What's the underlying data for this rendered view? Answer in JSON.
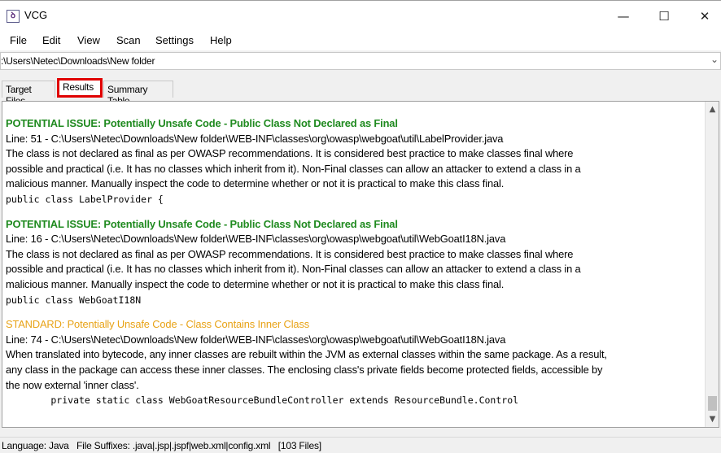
{
  "window": {
    "title": "VCG",
    "icon": "vcg-app-icon",
    "min_glyph": "—",
    "max_glyph": "☐",
    "close_glyph": "✕"
  },
  "menu": [
    "File",
    "Edit",
    "View",
    "Scan",
    "Settings",
    "Help"
  ],
  "path": {
    "value": ":\\Users\\Netec\\Downloads\\New folder"
  },
  "tabs": {
    "target_files": "Target Files",
    "results": "Results",
    "summary_table": "Summary Table",
    "highlight_color": "#e00000"
  },
  "results": [
    {
      "level": "potential",
      "heading": "POTENTIAL ISSUE: Potentially Unsafe Code - Public Class Not Declared as Final",
      "location": "Line: 51 - C:\\Users\\Netec\\Downloads\\New folder\\WEB-INF\\classes\\org\\owasp\\webgoat\\util\\LabelProvider.java",
      "desc": [
        "The class is not declared as final as per OWASP recommendations. It is considered best practice to make classes final where",
        "possible and practical (i.e. It has no classes which inherit from it). Non-Final classes can allow an attacker to extend a class in a",
        "malicious manner. Manually inspect the code to determine whether or not it is practical to make this class final."
      ],
      "code": "public class LabelProvider {"
    },
    {
      "level": "potential",
      "heading": "POTENTIAL ISSUE: Potentially Unsafe Code - Public Class Not Declared as Final",
      "location": "Line: 16 - C:\\Users\\Netec\\Downloads\\New folder\\WEB-INF\\classes\\org\\owasp\\webgoat\\util\\WebGoatI18N.java",
      "desc": [
        "The class is not declared as final as per OWASP recommendations. It is considered best practice to make classes final where",
        "possible and practical (i.e. It has no classes which inherit from it). Non-Final classes can allow an attacker to extend a class in a",
        "malicious manner. Manually inspect the code to determine whether or not it is practical to make this class final."
      ],
      "code": "public class WebGoatI18N"
    },
    {
      "level": "standard",
      "heading": "STANDARD: Potentially Unsafe Code - Class Contains Inner Class",
      "location": "Line: 74 - C:\\Users\\Netec\\Downloads\\New folder\\WEB-INF\\classes\\org\\owasp\\webgoat\\util\\WebGoatI18N.java",
      "desc": [
        "When translated into bytecode, any inner classes are rebuilt within the JVM as external classes within the same package. As a result,",
        "any class in the package can access these inner classes. The enclosing class's private fields become protected fields, accessible by",
        "the now external 'inner class'."
      ],
      "code": "        private static class WebGoatResourceBundleController extends ResourceBundle.Control"
    }
  ],
  "colors": {
    "potential": "#1f8a1f",
    "standard": "#e8a317"
  },
  "status": {
    "text": "Language: Java   File Suffixes: .java|.jsp|.jspf|web.xml|config.xml   [103 Files]"
  }
}
